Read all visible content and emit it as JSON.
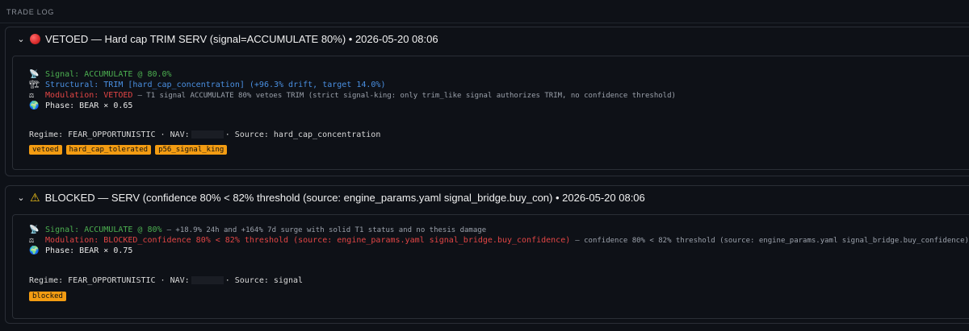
{
  "section_title": "TRADE LOG",
  "entries": [
    {
      "header": "VETOED — Hard cap TRIM SERV (signal=ACCUMULATE 80%) • 2026-05-20 08:06",
      "status_icon": "red-circle",
      "lines": {
        "signal_icon": "📡",
        "signal": "Signal: ACCUMULATE @ 80.0%",
        "structural_icon": "🏗",
        "structural": "Structural: TRIM [hard_cap_concentration] (+96.3% drift, target 14.0%)",
        "modulation_icon": "⚖",
        "modulation": "Modulation: VETOED",
        "modulation_note": "— T1 signal ACCUMULATE 80% vetoes TRIM (strict signal-king: only trim_like signal authorizes TRIM, no confidence threshold)",
        "phase_icon": "🌍",
        "phase": "Phase: BEAR × 0.65"
      },
      "regime_prefix": "Regime: FEAR_OPPORTUNISTIC · NAV:",
      "source": "· Source: hard_cap_concentration",
      "tags": [
        "vetoed",
        "hard_cap_tolerated",
        "p56_signal_king"
      ]
    },
    {
      "header": "BLOCKED — SERV (confidence 80% < 82% threshold (source: engine_params.yaml signal_bridge.buy_con) • 2026-05-20 08:06",
      "status_icon": "warning",
      "lines": {
        "signal_icon": "📡",
        "signal": "Signal: ACCUMULATE @ 80%",
        "signal_note": "— +18.9% 24h and +164% 7d surge with solid T1 status and no thesis damage",
        "modulation_icon": "⚖",
        "modulation": "Modulation: BLOCKED_confidence 80% < 82% threshold (source: engine_params.yaml signal_bridge.buy_confidence)",
        "modulation_note": "— confidence 80% < 82% threshold (source: engine_params.yaml signal_bridge.buy_confidence)",
        "phase_icon": "🌍",
        "phase": "Phase: BEAR × 0.75"
      },
      "regime_prefix": "Regime: FEAR_OPPORTUNISTIC · NAV:",
      "source": "· Source: signal",
      "tags": [
        "blocked"
      ]
    }
  ],
  "colors": {
    "background": "#0e1117",
    "signal": "#4caf50",
    "structural": "#4a90e2",
    "modulation": "#e24545",
    "tag": "#f39c12"
  }
}
